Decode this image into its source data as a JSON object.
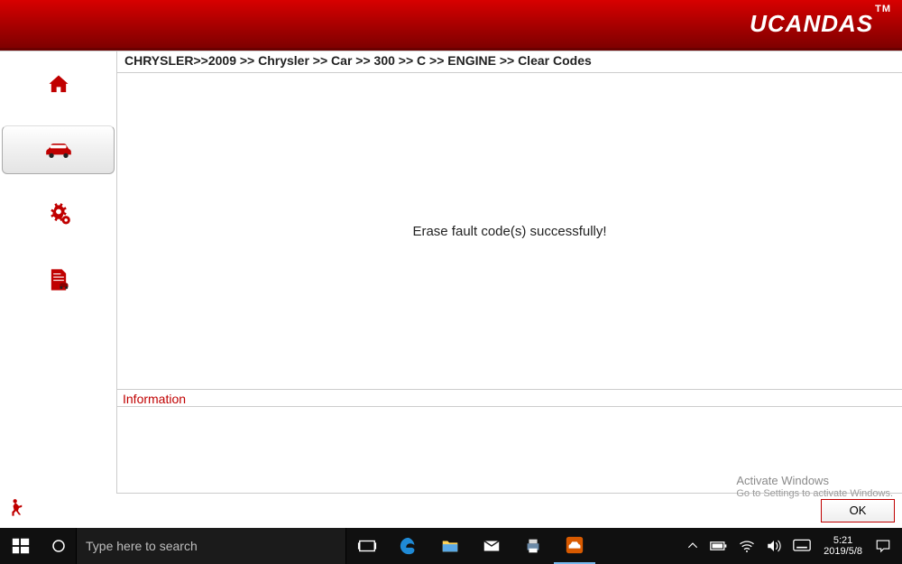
{
  "brand": {
    "name": "UCANDAS",
    "tm": "TM"
  },
  "sidebar": {
    "items": [
      {
        "name": "home"
      },
      {
        "name": "vehicle"
      },
      {
        "name": "settings"
      },
      {
        "name": "report"
      }
    ],
    "selected_index": 1
  },
  "breadcrumb": "CHRYSLER>>2009 >> Chrysler >> Car >> 300 >> C >> ENGINE >> Clear Codes",
  "message": "Erase fault code(s) successfully!",
  "info_label": "Information",
  "footer": {
    "ok_label": "OK"
  },
  "watermark": {
    "line1": "Activate Windows",
    "line2": "Go to Settings to activate Windows."
  },
  "taskbar": {
    "search_placeholder": "Type here to search",
    "clock_time": "5:21",
    "clock_date": "2019/5/8"
  }
}
